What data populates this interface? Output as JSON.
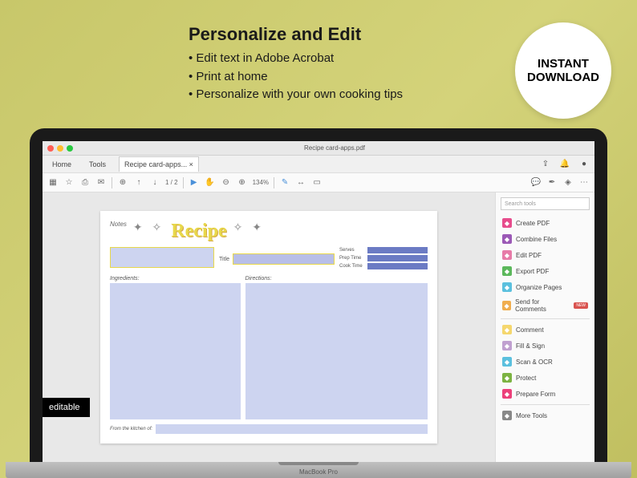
{
  "headline": "Personalize and Edit",
  "bullets": [
    "Edit text in Adobe Acrobat",
    "Print at home",
    "Personalize with your own cooking tips"
  ],
  "badge": {
    "line1": "INSTANT",
    "line2": "DOWNLOAD"
  },
  "editable_tag": "editable",
  "laptop_model": "MacBook Pro",
  "window": {
    "title": "Recipe card-apps.pdf",
    "tabs": {
      "home": "Home",
      "tools": "Tools",
      "file": "Recipe card-apps..."
    },
    "toolbar": {
      "page_current": "1",
      "page_total": "2",
      "zoom": "134%"
    }
  },
  "sidebar": {
    "search_placeholder": "Search tools",
    "items": [
      {
        "label": "Create PDF",
        "icon": "ic-create"
      },
      {
        "label": "Combine Files",
        "icon": "ic-combine"
      },
      {
        "label": "Edit PDF",
        "icon": "ic-edit"
      },
      {
        "label": "Export PDF",
        "icon": "ic-export"
      },
      {
        "label": "Organize Pages",
        "icon": "ic-organize"
      },
      {
        "label": "Send for Comments",
        "icon": "ic-send",
        "new": "NEW"
      },
      {
        "label": "Comment",
        "icon": "ic-comment"
      },
      {
        "label": "Fill & Sign",
        "icon": "ic-fill"
      },
      {
        "label": "Scan & OCR",
        "icon": "ic-scan"
      },
      {
        "label": "Protect",
        "icon": "ic-protect"
      },
      {
        "label": "Prepare Form",
        "icon": "ic-prepare"
      },
      {
        "label": "More Tools",
        "icon": "ic-more"
      }
    ]
  },
  "recipe": {
    "notes_label": "Notes",
    "script_title": "Recipe",
    "title_label": "Title",
    "serves_label": "Serves",
    "prep_label": "Prep Time",
    "cook_label": "Cook Time",
    "ingredients_label": "Ingredients:",
    "directions_label": "Directions:",
    "from_label": "From the kitchen of:"
  }
}
